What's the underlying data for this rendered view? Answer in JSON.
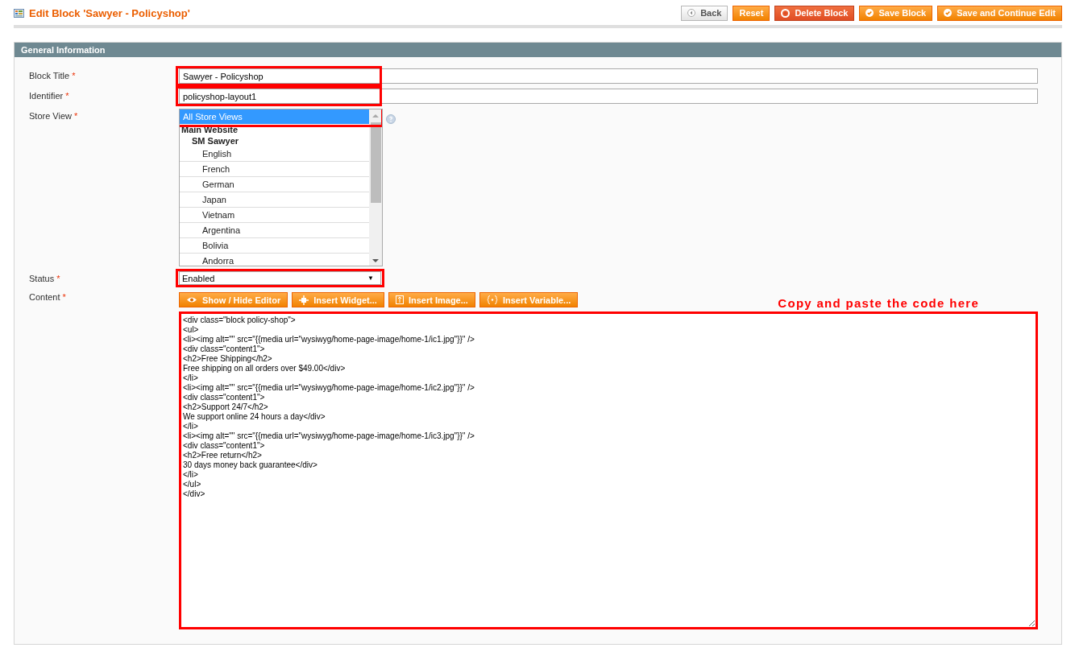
{
  "header": {
    "title": "Edit Block 'Sawyer - Policyshop'"
  },
  "buttons": [
    {
      "kind": "back",
      "label": "Back"
    },
    {
      "kind": "plain",
      "label": "Reset"
    },
    {
      "kind": "delete",
      "label": "Delete Block"
    },
    {
      "kind": "save",
      "label": "Save Block"
    },
    {
      "kind": "save",
      "label": "Save and Continue Edit"
    }
  ],
  "section": {
    "title": "General Information"
  },
  "fields": {
    "block_title": {
      "label": "Block Title",
      "required": "*",
      "value": "Sawyer - Policyshop",
      "highlighted": true
    },
    "identifier": {
      "label": "Identifier",
      "required": "*",
      "value": "policyshop-layout1",
      "highlighted": true
    },
    "store_view": {
      "label": "Store View",
      "required": "*",
      "highlighted": true,
      "options": [
        {
          "label": "All Store Views",
          "selected": true
        },
        {
          "label": "Main Website",
          "selected": false,
          "children": [
            {
              "label": "SM Sawyer",
              "selected": false,
              "children": [
                {
                  "label": "English",
                  "selected": false
                },
                {
                  "label": "French",
                  "selected": false
                },
                {
                  "label": "German",
                  "selected": false
                },
                {
                  "label": "Japan",
                  "selected": false
                },
                {
                  "label": "Vietnam",
                  "selected": false
                },
                {
                  "label": "Argentina",
                  "selected": false
                },
                {
                  "label": "Bolivia",
                  "selected": false
                },
                {
                  "label": "Andorra",
                  "selected": false
                }
              ]
            }
          ]
        }
      ]
    },
    "status": {
      "label": "Status",
      "required": "*",
      "value": "Enabled",
      "caret": "▼",
      "highlighted": true
    },
    "content": {
      "label": "Content",
      "required": "*",
      "highlighted": true,
      "toolbar": [
        {
          "kind": "eye",
          "label": "Show / Hide Editor"
        },
        {
          "kind": "widget",
          "label": "Insert Widget..."
        },
        {
          "kind": "image",
          "label": "Insert Image..."
        },
        {
          "kind": "variable",
          "label": "Insert Variable..."
        }
      ],
      "note": "Copy and paste the code here",
      "value": "<div class=\"block policy-shop\">\n<ul>\n<li><img alt=\"\" src=\"{{media url=\"wysiwyg/home-page-image/home-1/ic1.jpg\"}}\" />\n<div class=\"content1\">\n<h2>Free Shipping</h2>\nFree shipping on all orders over $49.00</div>\n</li>\n<li><img alt=\"\" src=\"{{media url=\"wysiwyg/home-page-image/home-1/ic2.jpg\"}}\" />\n<div class=\"content1\">\n<h2>Support 24/7</h2>\nWe support online 24 hours a day</div>\n</li>\n<li><img alt=\"\" src=\"{{media url=\"wysiwyg/home-page-image/home-1/ic3.jpg\"}}\" />\n<div class=\"content1\">\n<h2>Free return</h2>\n30 days money back guarantee</div>\n</li>\n</ul>\n</div>"
    }
  }
}
